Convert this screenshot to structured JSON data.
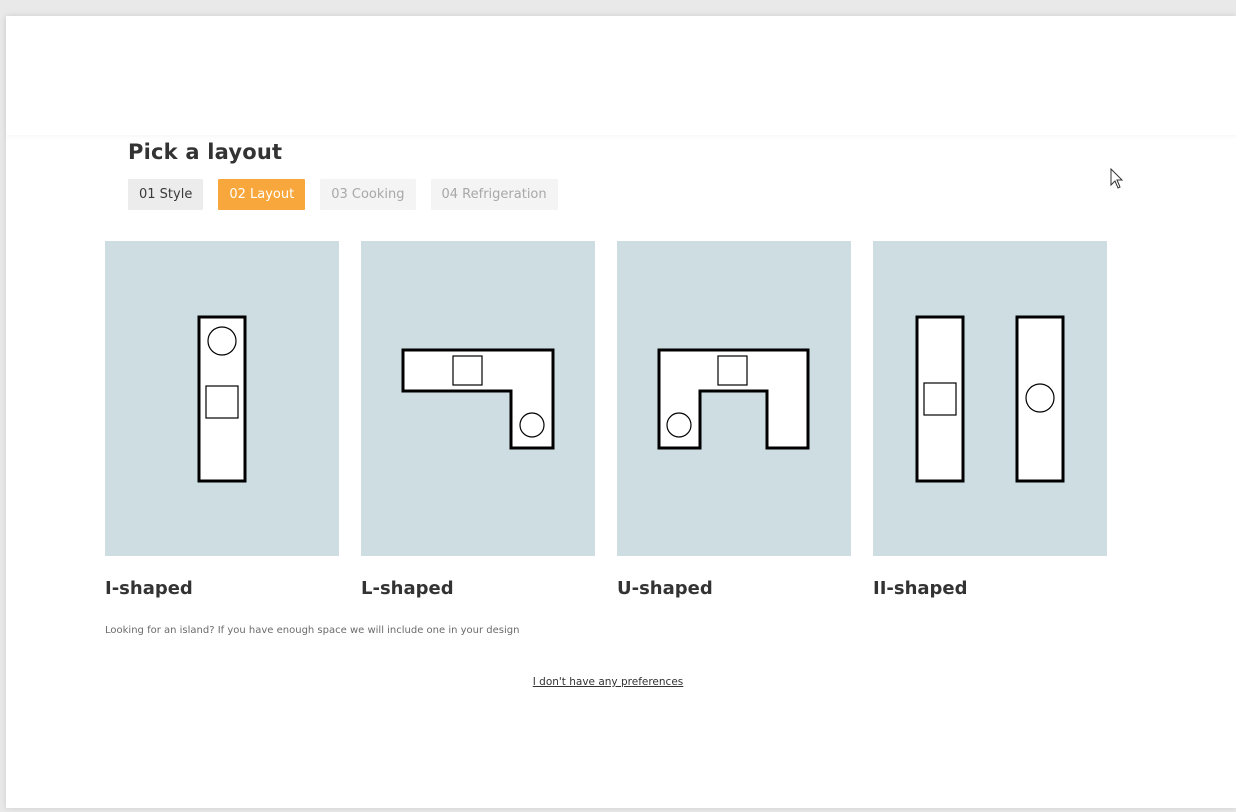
{
  "page": {
    "title": "Pick a layout",
    "hint": "Looking for an island? If you have enough space we will include one in your design",
    "no_preference_link": "I don't have any preferences"
  },
  "steps": [
    {
      "label": "01 Style",
      "state": "done"
    },
    {
      "label": "02 Layout",
      "state": "active"
    },
    {
      "label": "03 Cooking",
      "state": "future"
    },
    {
      "label": "04 Refrigeration",
      "state": "future"
    }
  ],
  "layouts": [
    {
      "label": "I-shaped",
      "icon": "i-shaped-layout-icon"
    },
    {
      "label": "L-shaped",
      "icon": "l-shaped-layout-icon"
    },
    {
      "label": "U-shaped",
      "icon": "u-shaped-layout-icon"
    },
    {
      "label": "II-shaped",
      "icon": "ii-shaped-layout-icon"
    }
  ],
  "colors": {
    "accent": "#f8a73c",
    "card_background": "#cddde2",
    "text": "#333333"
  }
}
